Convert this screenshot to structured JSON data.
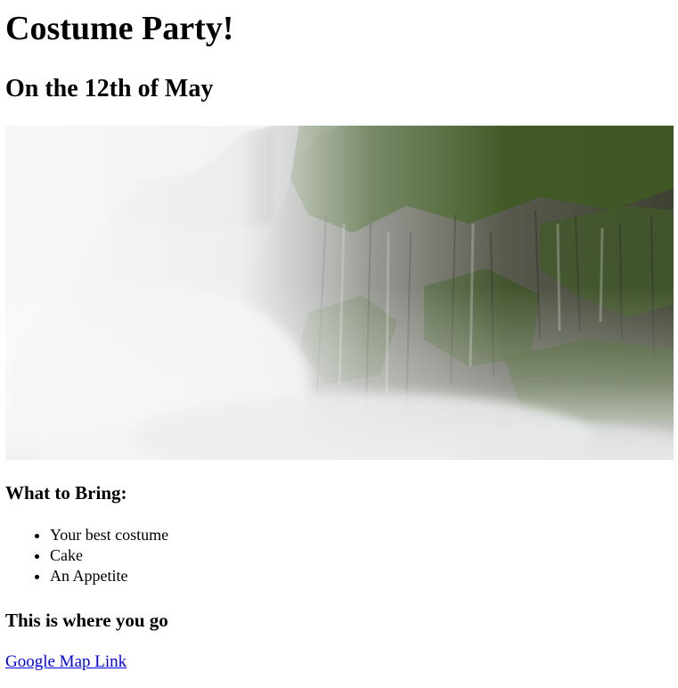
{
  "page": {
    "title": "Costume Party!",
    "subtitle": "On the 12th of May"
  },
  "hero_image": {
    "subject": "misty-cliff-photo"
  },
  "bring": {
    "heading": "What to Bring:",
    "items": [
      "Your best costume",
      "Cake",
      "An Appetite"
    ]
  },
  "location": {
    "heading": "This is where you go",
    "link_text": "Google Map Link"
  },
  "colors": {
    "link": "#0000ee",
    "text": "#000000",
    "background": "#ffffff"
  }
}
